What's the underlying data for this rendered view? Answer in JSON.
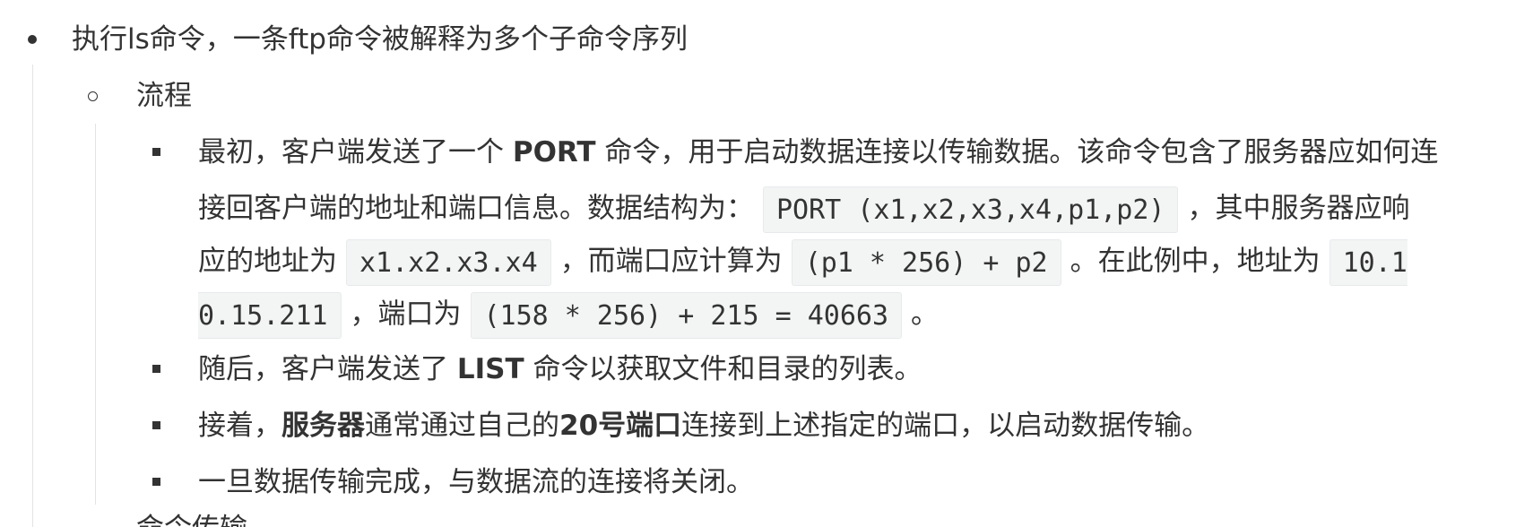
{
  "items": {
    "level1": "执行ls命令，一条ftp命令被解释为多个子命令序列",
    "level2": "流程",
    "step1": {
      "t1": "最初，客户端发送了一个 ",
      "b1": "PORT",
      "t2": " 命令，用于启动数据连接以传输数据。该命令包含了服务器应如何连",
      "t3": "接回客户端的地址和端口信息。数据结构为：",
      "code1": "PORT (x1,x2,x3,x4,p1,p2)",
      "t4": "，其中服务器应响",
      "t5": "应的地址为",
      "code2": "x1.x2.x3.x4",
      "t6": "，而端口应计算为",
      "code3": "(p1 * 256) + p2",
      "t7": "。在此例中，地址为",
      "code4a": "10.1",
      "code4b": "0.15.211",
      "t8": "，端口为",
      "code5": "(158 * 256) + 215 = 40663",
      "t9": "。"
    },
    "step2": {
      "t1": "随后，客户端发送了 ",
      "b1": "LIST",
      "t2": " 命令以获取文件和目录的列表。"
    },
    "step3": {
      "t1": "接着，",
      "b1": "服务器",
      "t2": "通常通过自己的",
      "b2": "20号端口",
      "t3": "连接到上述指定的端口，以启动数据传输。"
    },
    "step4": "一旦数据传输完成，与数据流的连接将关闭。",
    "next_cut": "命令传输"
  }
}
